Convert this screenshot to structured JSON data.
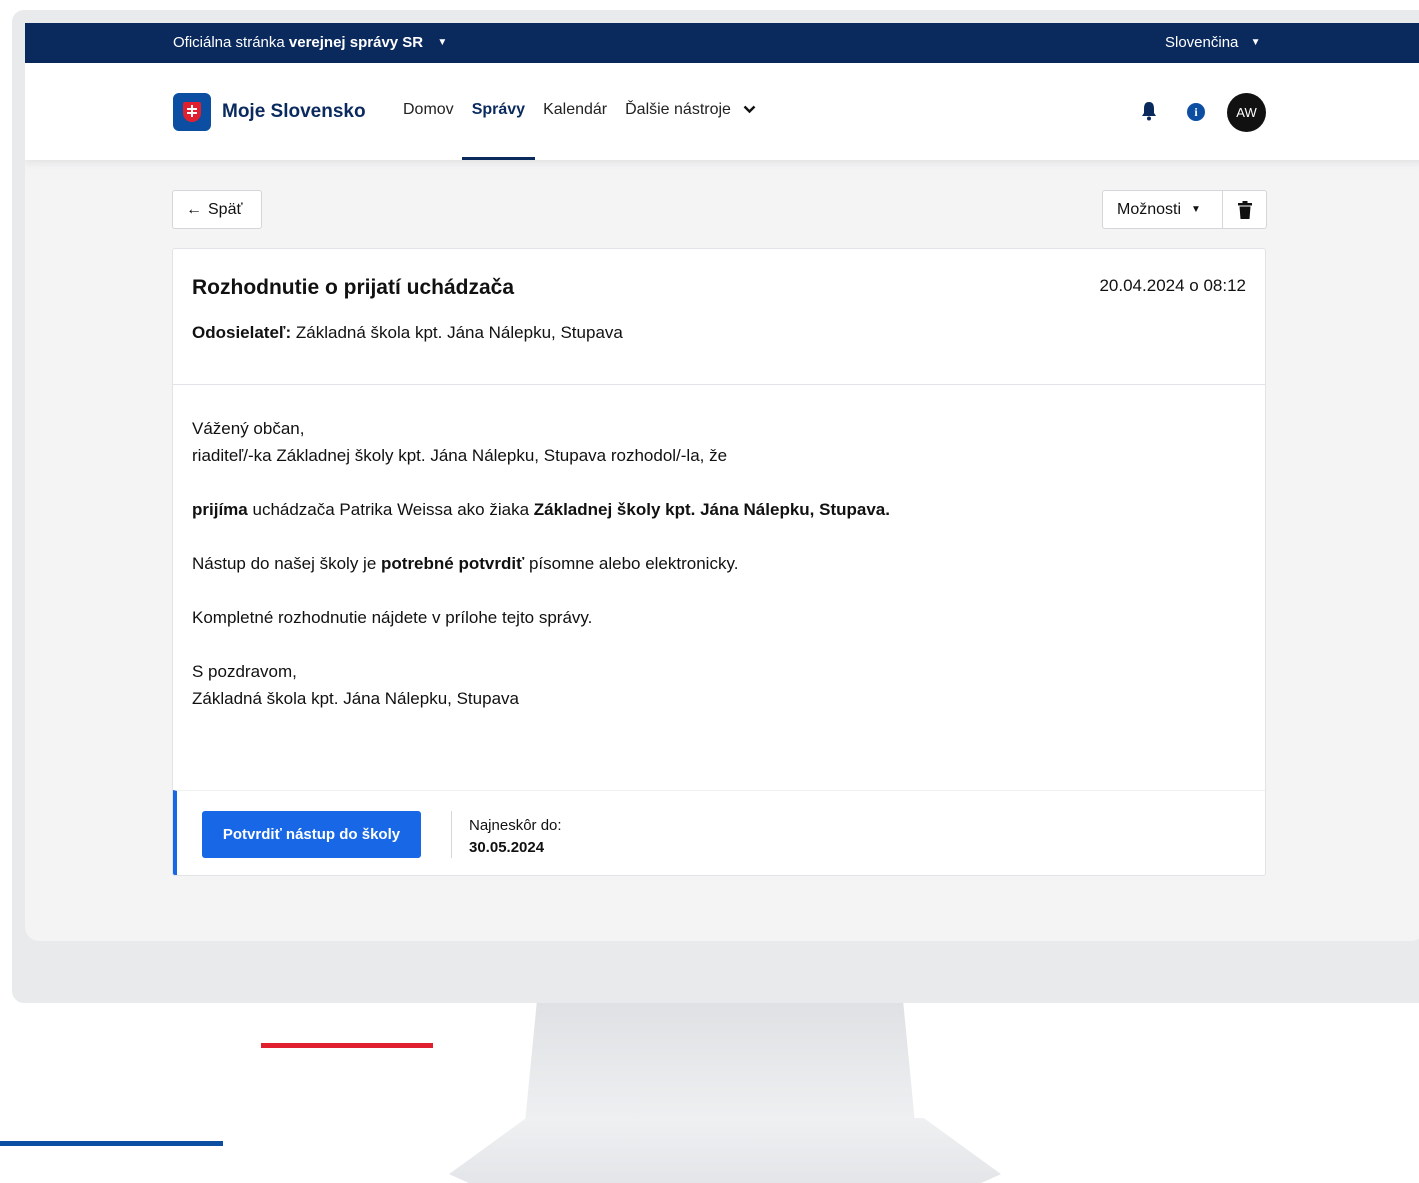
{
  "gov_bar": {
    "text_prefix": "Oficiálna stránka",
    "text_bold": "verejnej správy SR",
    "language": "Slovenčina"
  },
  "header": {
    "brand": "Moje Slovensko",
    "nav": [
      "Domov",
      "Správy",
      "Kalendár",
      "Ďalšie nástroje"
    ],
    "avatar_initials": "AW"
  },
  "toolbar": {
    "back_label": "Späť",
    "options_label": "Možnosti"
  },
  "message": {
    "title": "Rozhodnutie o prijatí uchádzača",
    "date": "20.04.2024 o 08:12",
    "sender_label": "Odosielateľ:",
    "sender": "Základná škola kpt. Jána Nálepku, Stupava",
    "greeting": "Vážený občan,",
    "intro": "riaditeľ/-ka Základnej školy kpt. Jána Nálepku, Stupava rozhodol/-la, že",
    "decision_bold": "prijíma",
    "decision_text": "uchádzača Patrika Weissa ako žiaka",
    "decision_school": "Základnej školy kpt. Jána Nálepku, Stupava.",
    "confirm_prefix": "Nástup do našej školy je",
    "confirm_bold": "potrebné potvrdiť",
    "confirm_suffix": "písomne alebo elektronicky.",
    "attachment_note": "Kompletné rozhodnutie nájdete v prílohe tejto správy.",
    "closing": "S pozdravom,",
    "signature": "Základná škola kpt. Jána Nálepku, Stupava"
  },
  "action": {
    "button_label": "Potvrdiť nástup do školy",
    "deadline_label": "Najneskôr do:",
    "deadline_date": "30.05.2024"
  },
  "colors": {
    "gov_bar": "#0a2a5e",
    "primary": "#1767e6",
    "brand_red": "#e0202f",
    "brand_blue": "#0b4ea2"
  }
}
